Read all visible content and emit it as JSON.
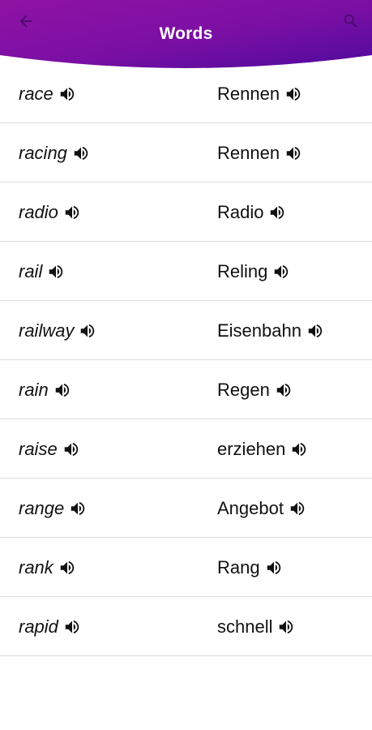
{
  "header": {
    "title": "Words",
    "back_icon": "arrow-left-icon",
    "search_icon": "search-icon",
    "gradient_left": "#8e0f9f",
    "gradient_right": "#5a0ba0"
  },
  "words": [
    {
      "en": "race",
      "de": "Rennen"
    },
    {
      "en": "racing",
      "de": "Rennen"
    },
    {
      "en": "radio",
      "de": "Radio"
    },
    {
      "en": "rail",
      "de": "Reling"
    },
    {
      "en": "railway",
      "de": "Eisenbahn"
    },
    {
      "en": "rain",
      "de": "Regen"
    },
    {
      "en": "raise",
      "de": "erziehen"
    },
    {
      "en": "range",
      "de": "Angebot"
    },
    {
      "en": "rank",
      "de": "Rang"
    },
    {
      "en": "rapid",
      "de": "schnell"
    }
  ],
  "speaker_icon": "speaker-icon"
}
